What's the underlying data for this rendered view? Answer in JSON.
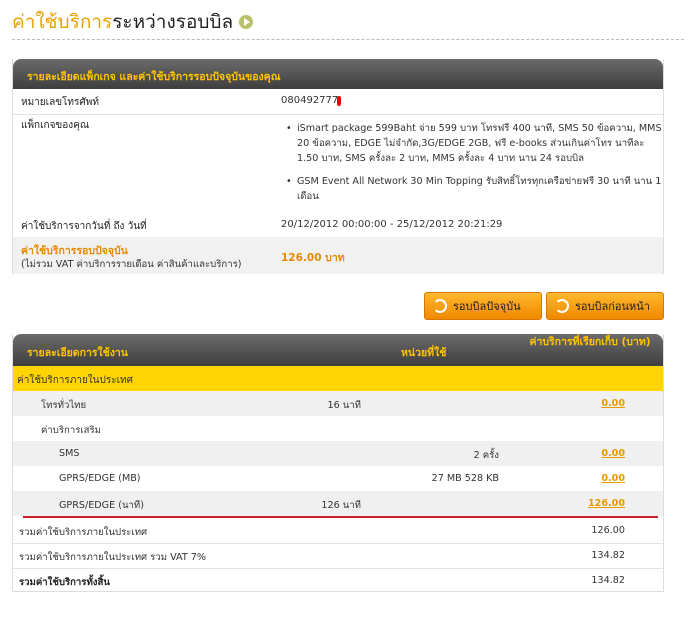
{
  "page": {
    "title_part1": "ค่าใช้บริการ",
    "title_part2": "ระหว่างรอบบิล",
    "play_icon": "circle-play-icon"
  },
  "package_panel": {
    "header": "รายละเอียดแพ็กเกจ และค่าใช้บริการรอบปัจจุบันของคุณ",
    "phone_label": "หมายเลขโทรศัพท์",
    "phone_value": "080492777",
    "package_label": "แพ็กเกจของคุณ",
    "packages": [
      "iSmart package 599Baht จ่าย 599 บาท โทรฟรี 400 นาที, SMS 50 ข้อความ, MMS 20 ข้อความ, EDGE ไม่จำกัด,3G/EDGE 2GB, ฟรี e-books ส่วนเกินค่าโทร นาทีละ 1.50 บาท, SMS ครั้งละ 2 บาท, MMS ครั้งละ 4 บาท นาน 24 รอบบิล",
      "GSM Event All Network 30 Min Topping รับสิทธิ์โทรทุกเครือข่ายฟรี 30 นาที นาน 1 เดือน"
    ],
    "period_label": "ค่าใช้บริการจากวันที่ ถึง วันที่",
    "period_value": "20/12/2012 00:00:00 - 25/12/2012 20:21:29",
    "current_label": "ค่าใช้บริการรอบปัจจุบัน",
    "current_note": "(ไม่รวม VAT ค่าบริการรายเดือน ค่าสินค้าและบริการ)",
    "current_amount": "126.00 บาท"
  },
  "buttons": {
    "current_cycle": "รอบบิลปัจจุบัน",
    "previous_cycle": "รอบบิลก่อนหน้า"
  },
  "usage_panel": {
    "col_detail": "รายละเอียดการใช้งาน",
    "col_unit": "หน่วยที่ใช้",
    "col_charge": "ค่าบริการที่เรียกเก็บ (บาท)",
    "category": "ค่าใช้บริการภายในประเทศ",
    "rows": [
      {
        "label": "โทรทั่วไทย",
        "qty": "16 นาที",
        "amount": ""
      },
      {
        "label": "ค่าบริการเสริม",
        "qty": "",
        "amount": ""
      },
      {
        "label": "SMS",
        "qty": "2 ครั้ง",
        "amount": ""
      },
      {
        "label": "GPRS/EDGE (MB)",
        "qty": "27 MB 528 KB",
        "amount": "0.00"
      },
      {
        "label": "GPRS/EDGE (นาที)",
        "qty": "126 นาที",
        "amount": "126.00"
      }
    ],
    "amount_0": "0.00",
    "amount_2": "0.00",
    "totals": [
      {
        "label": "รวมค่าใช้บริการภายในประเทศ",
        "amount": "126.00"
      },
      {
        "label": "รวมค่าใช้บริการภายในประเทศ รวม VAT 7%",
        "amount": "134.82"
      },
      {
        "label": "รวมค่าใช้บริการทั้งสิ้น",
        "amount": "134.82"
      }
    ]
  },
  "colors": {
    "accent_orange": "#e68a00",
    "category_yellow": "#ffd400",
    "header_dark": "#4a4a4a",
    "header_text": "#ffc400",
    "highlight_line": "#c8202a"
  }
}
